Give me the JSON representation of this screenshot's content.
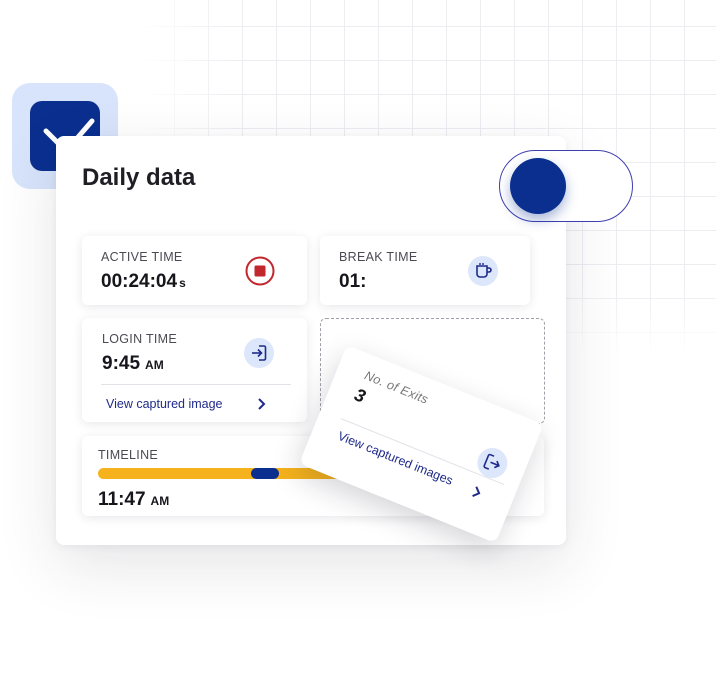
{
  "card": {
    "title": "Daily data"
  },
  "toggle": {
    "state": "on",
    "accent": "#0a2f8f"
  },
  "active_time": {
    "label": "ACTIVE TIME",
    "value": "00:24:04",
    "unit": "s",
    "icon": "stop-icon"
  },
  "break_time": {
    "label": "BREAK TIME",
    "value": "01:",
    "icon": "coffee-cup-icon"
  },
  "login_time": {
    "label": "LOGIN TIME",
    "value": "9:45",
    "unit": "AM",
    "icon": "login-icon",
    "link": "View captured image"
  },
  "exits": {
    "label": "No. of Exits",
    "value": "3",
    "icon": "logout-icon",
    "link": "View captured images"
  },
  "timeline": {
    "label": "TIMELINE",
    "time": "11:47",
    "unit": "AM",
    "colors": {
      "active": "#f5b21c",
      "break": "#0a2f8f"
    }
  }
}
